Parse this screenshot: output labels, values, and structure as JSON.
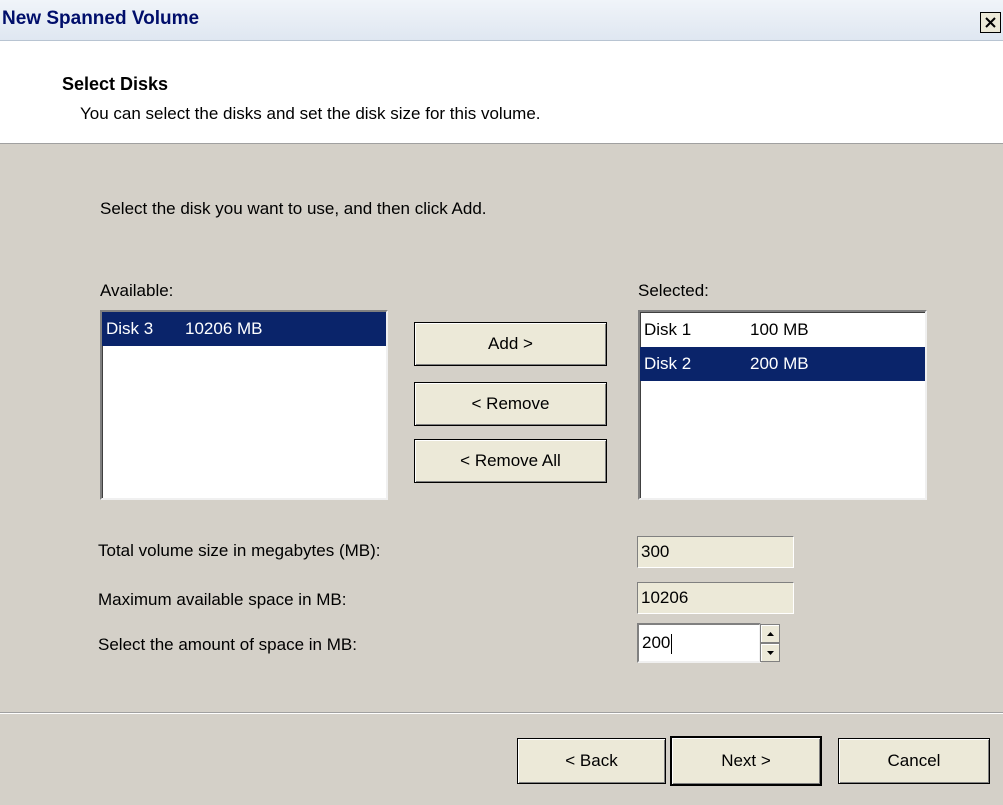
{
  "window": {
    "title": "New Spanned Volume",
    "close_glyph": "✕"
  },
  "header": {
    "title": "Select Disks",
    "subtitle": "You can select the disks and set the disk size for this volume."
  },
  "instruction": "Select the disk you want to use, and then click Add.",
  "available": {
    "label": "Available:",
    "items": [
      {
        "disk": "Disk 3",
        "size": "10206 MB",
        "selected": true
      }
    ]
  },
  "selected": {
    "label": "Selected:",
    "items": [
      {
        "disk": "Disk 1",
        "size": "100 MB",
        "selected": false
      },
      {
        "disk": "Disk 2",
        "size": "200 MB",
        "selected": true
      }
    ]
  },
  "buttons": {
    "add": "Add >",
    "remove": "< Remove",
    "remove_all": "< Remove All",
    "back": "< Back",
    "next": "Next >",
    "cancel": "Cancel"
  },
  "fields": {
    "total_label": "Total volume size in megabytes (MB):",
    "total_value": "300",
    "max_label": "Maximum available space in MB:",
    "max_value": "10206",
    "amount_label": "Select the amount of space in MB:",
    "amount_value": "200"
  },
  "colors": {
    "selection": "#0a246a",
    "dialog_bg": "#d4d0c8",
    "title_text": "#000e6b"
  }
}
